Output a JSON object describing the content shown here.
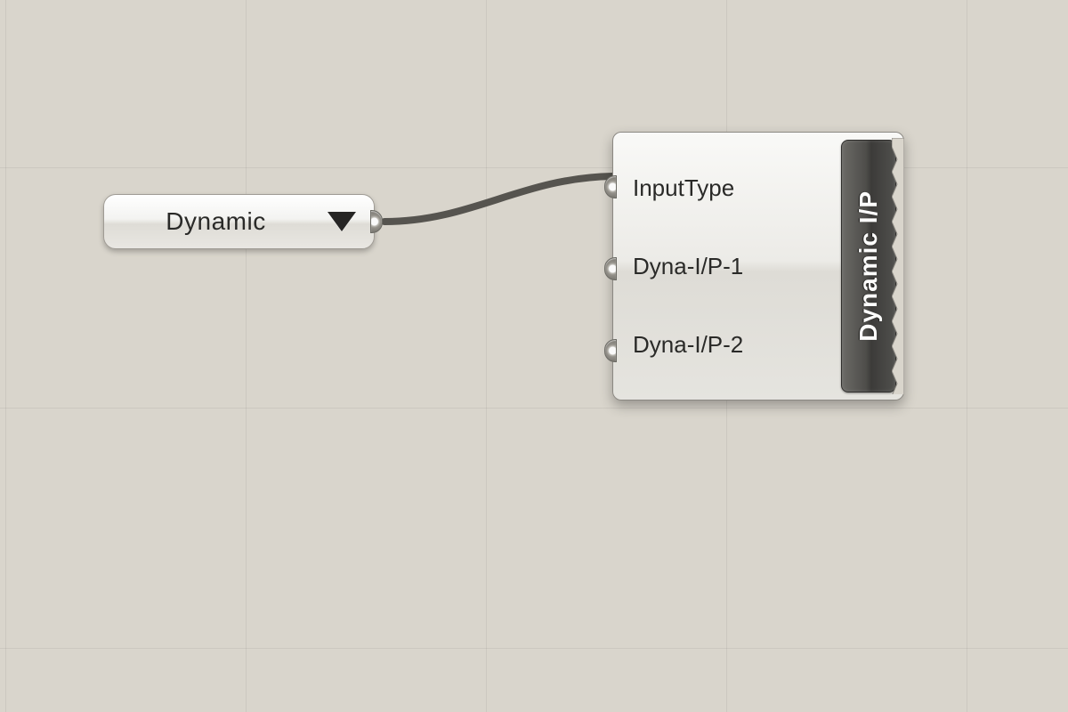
{
  "canvas": {
    "bg_color": "#d9d5cc",
    "grid_color": "rgba(0,0,0,0.06)"
  },
  "dropdown": {
    "label": "Dynamic"
  },
  "component": {
    "title": "Dynamic I/P",
    "inputs": [
      "InputType",
      "Dyna-I/P-1",
      "Dyna-I/P-2"
    ]
  }
}
